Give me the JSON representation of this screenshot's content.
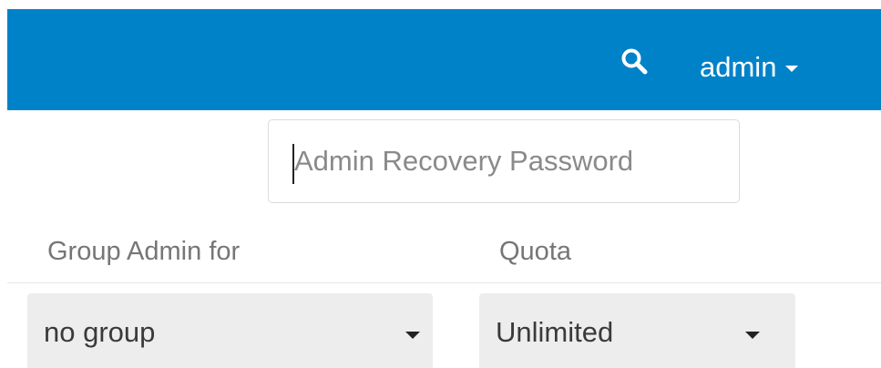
{
  "header": {
    "search_icon": "search-icon",
    "user": {
      "name": "admin",
      "caret_icon": "caret-down-icon"
    },
    "background_color": "#0082c9"
  },
  "recovery_password": {
    "placeholder": "Admin Recovery Password",
    "value": ""
  },
  "columns": {
    "group_admin_label": "Group Admin for",
    "quota_label": "Quota"
  },
  "row": {
    "group_admin": {
      "selected": "no group",
      "caret_icon": "caret-down-icon"
    },
    "quota": {
      "selected": "Unlimited",
      "caret_icon": "caret-down-icon"
    }
  }
}
